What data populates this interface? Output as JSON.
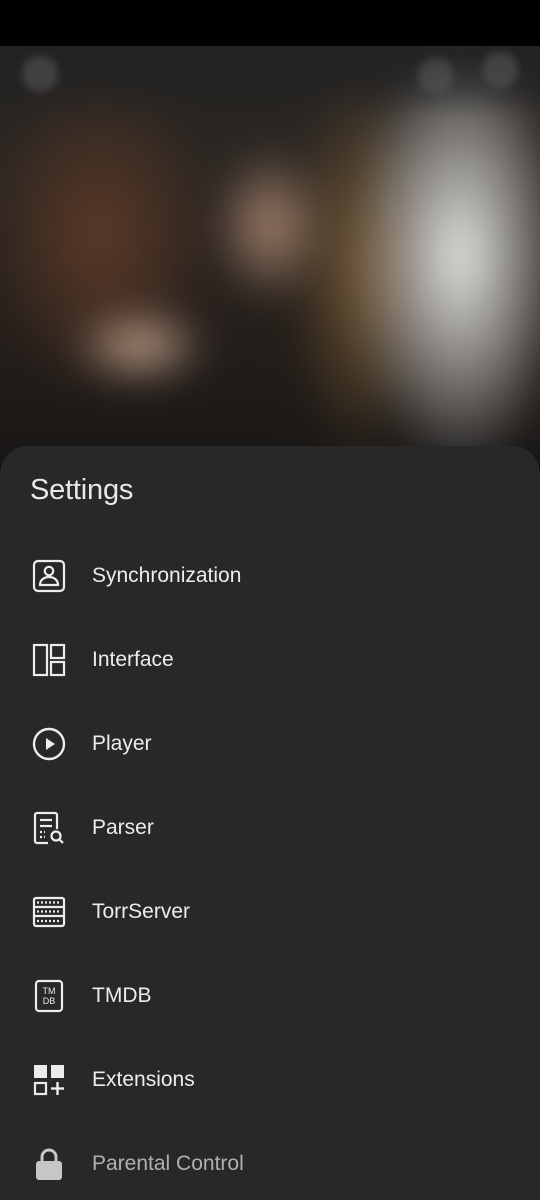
{
  "settings": {
    "title": "Settings",
    "items": [
      {
        "label": "Synchronization",
        "icon": "user-badge-icon"
      },
      {
        "label": "Interface",
        "icon": "layout-icon"
      },
      {
        "label": "Player",
        "icon": "play-circle-icon"
      },
      {
        "label": "Parser",
        "icon": "document-search-icon"
      },
      {
        "label": "TorrServer",
        "icon": "server-icon"
      },
      {
        "label": "TMDB",
        "icon": "tmdb-icon",
        "icon_text_top": "TM",
        "icon_text_bottom": "DB"
      },
      {
        "label": "Extensions",
        "icon": "extensions-icon"
      },
      {
        "label": "Parental Control",
        "icon": "lock-icon"
      }
    ]
  },
  "colors": {
    "sheet_background": "#282829",
    "text_primary": "#ececee",
    "text_dim": "#b0b0b3"
  }
}
